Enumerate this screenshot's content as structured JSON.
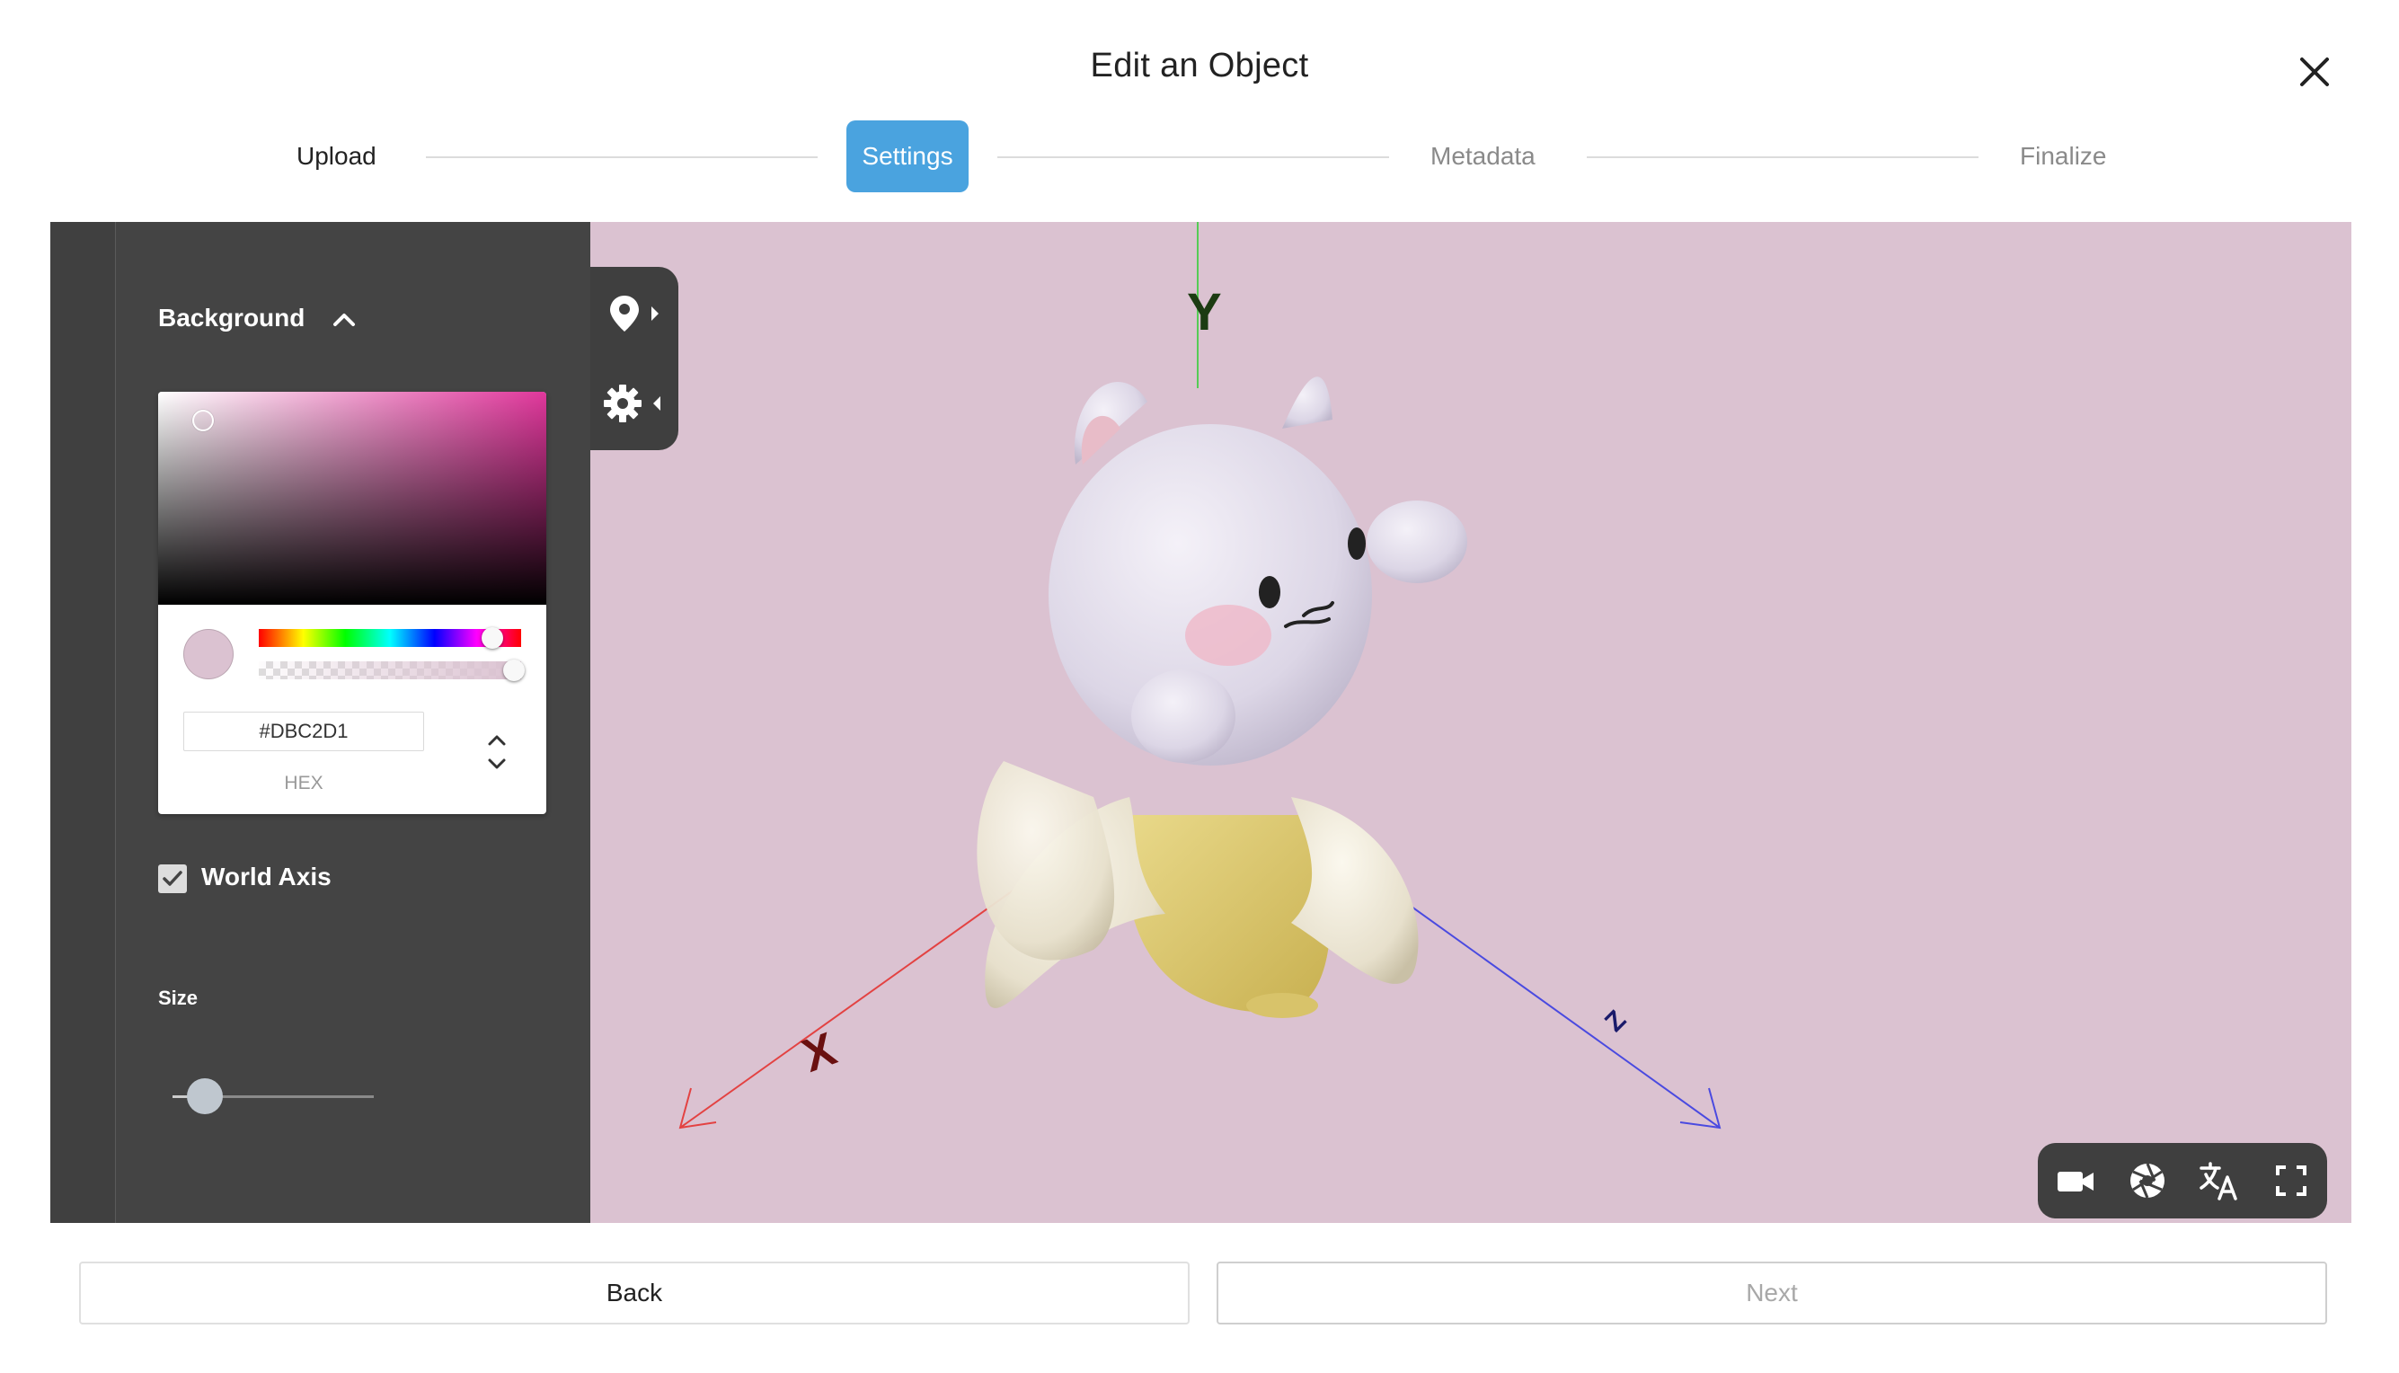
{
  "header": {
    "title": "Edit an Object"
  },
  "stepper": {
    "steps": [
      {
        "label": "Upload",
        "state": "complete"
      },
      {
        "label": "Settings",
        "state": "active"
      },
      {
        "label": "Metadata",
        "state": "inactive"
      },
      {
        "label": "Finalize",
        "state": "inactive"
      }
    ]
  },
  "panel": {
    "background": {
      "label": "Background",
      "color_hex": "#DBC2D1",
      "mode_label": "HEX",
      "hue_color": "#e0379b"
    },
    "world_axis": {
      "label": "World Axis",
      "checked": true
    },
    "size": {
      "label": "Size",
      "value_fraction": 0.16
    }
  },
  "viewport": {
    "background_color": "#dbc2d1",
    "axis_labels": {
      "x": "X",
      "y": "Y",
      "z": "Z"
    },
    "axis_colors": {
      "x": "#e34242",
      "y": "#55cc55",
      "z": "#4a4ae0"
    }
  },
  "footer": {
    "back_label": "Back",
    "next_label": "Next"
  },
  "icons": {
    "close": "close-icon",
    "chevron": "chevron-up-icon",
    "hotspot": "map-pin-icon",
    "settings": "gear-icon",
    "camera": "video-camera-icon",
    "aperture": "aperture-icon",
    "translate": "translate-icon",
    "fullscreen": "fullscreen-icon"
  }
}
